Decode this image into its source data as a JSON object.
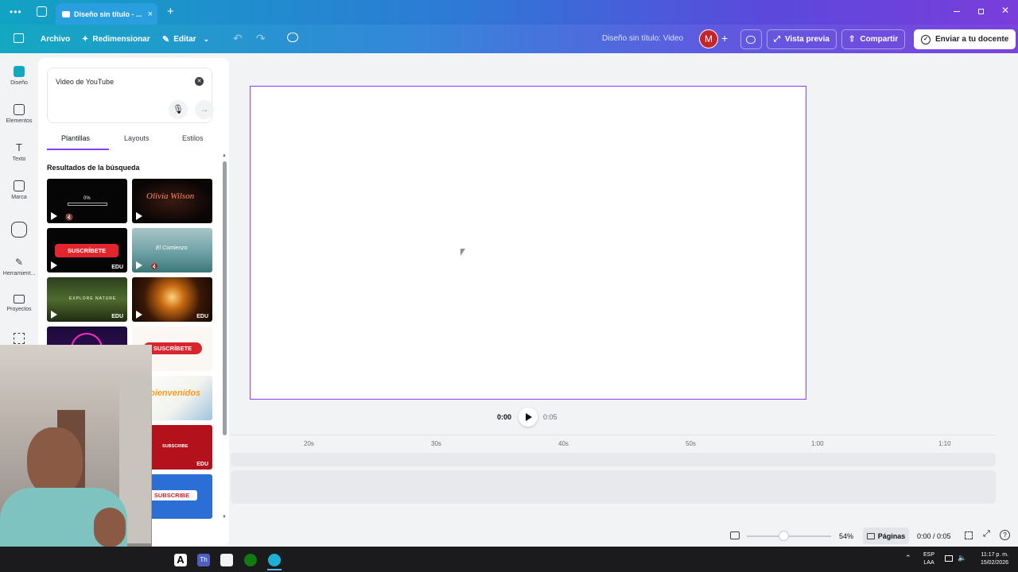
{
  "browser": {
    "tab_title": "Diseño sin título - ...",
    "new_tab": "+",
    "close_tab": "×"
  },
  "toolbar": {
    "archivo": "Archivo",
    "redimensionar": "Redimensionar",
    "editar": "Editar",
    "doc_title": "Diseño sin título: Video",
    "avatar_letter": "M",
    "vista_previa": "Vista previa",
    "compartir": "Compartir",
    "enviar": "Enviar a tu docente"
  },
  "rail": {
    "items": [
      {
        "label": "Diseño",
        "icon": "design-icon"
      },
      {
        "label": "Elementos",
        "icon": "elements-icon"
      },
      {
        "label": "Texto",
        "icon": "text-icon"
      },
      {
        "label": "Marca",
        "icon": "brand-icon"
      },
      {
        "label": "",
        "icon": "cloud-upload-icon"
      },
      {
        "label": "Herramient...",
        "icon": "tools-icon"
      },
      {
        "label": "Proyectos",
        "icon": "folder-icon"
      }
    ]
  },
  "panel": {
    "search_value": "Video de YouTube",
    "tabs": [
      "Plantillas",
      "Layouts",
      "Estilos"
    ],
    "results_heading": "Resultados de la búsqueda",
    "thumbs": [
      {
        "label": "0%",
        "edu": ""
      },
      {
        "label": "Olivia Wilson",
        "edu": ""
      },
      {
        "label": "SUSCRÍBETE",
        "edu": "EDU"
      },
      {
        "label": "El Comienzo",
        "edu": ""
      },
      {
        "label": "EXPLORE NATURE",
        "edu": "EDU"
      },
      {
        "label": "",
        "edu": "EDU"
      },
      {
        "label": "",
        "edu": ""
      },
      {
        "label": "SUSCRÍBETE",
        "edu": ""
      },
      {
        "label": "bienvenidos",
        "edu": ""
      },
      {
        "label": "SUBSCRIBE",
        "edu": "EDU"
      },
      {
        "label": "SUBSCRIBE",
        "edu": ""
      }
    ]
  },
  "player": {
    "current": "0:00",
    "duration": "0:05"
  },
  "timeline": {
    "ticks": [
      "20s",
      "30s",
      "40s",
      "50s",
      "1:00",
      "1:10"
    ]
  },
  "footer": {
    "zoom": "54%",
    "zoom_level": 0.43,
    "paginas": "Páginas",
    "time": "0:00 / 0:05"
  },
  "taskbar": {
    "lang_top": "ESP",
    "lang_bottom": "LAA",
    "clock": "11:17 p. m.",
    "date": "15/02/2026"
  },
  "colors": {
    "accent": "#8b3dff",
    "toolbar_start": "#13a8c2",
    "toolbar_end": "#7b43dc",
    "avatar": "#c4252b"
  }
}
